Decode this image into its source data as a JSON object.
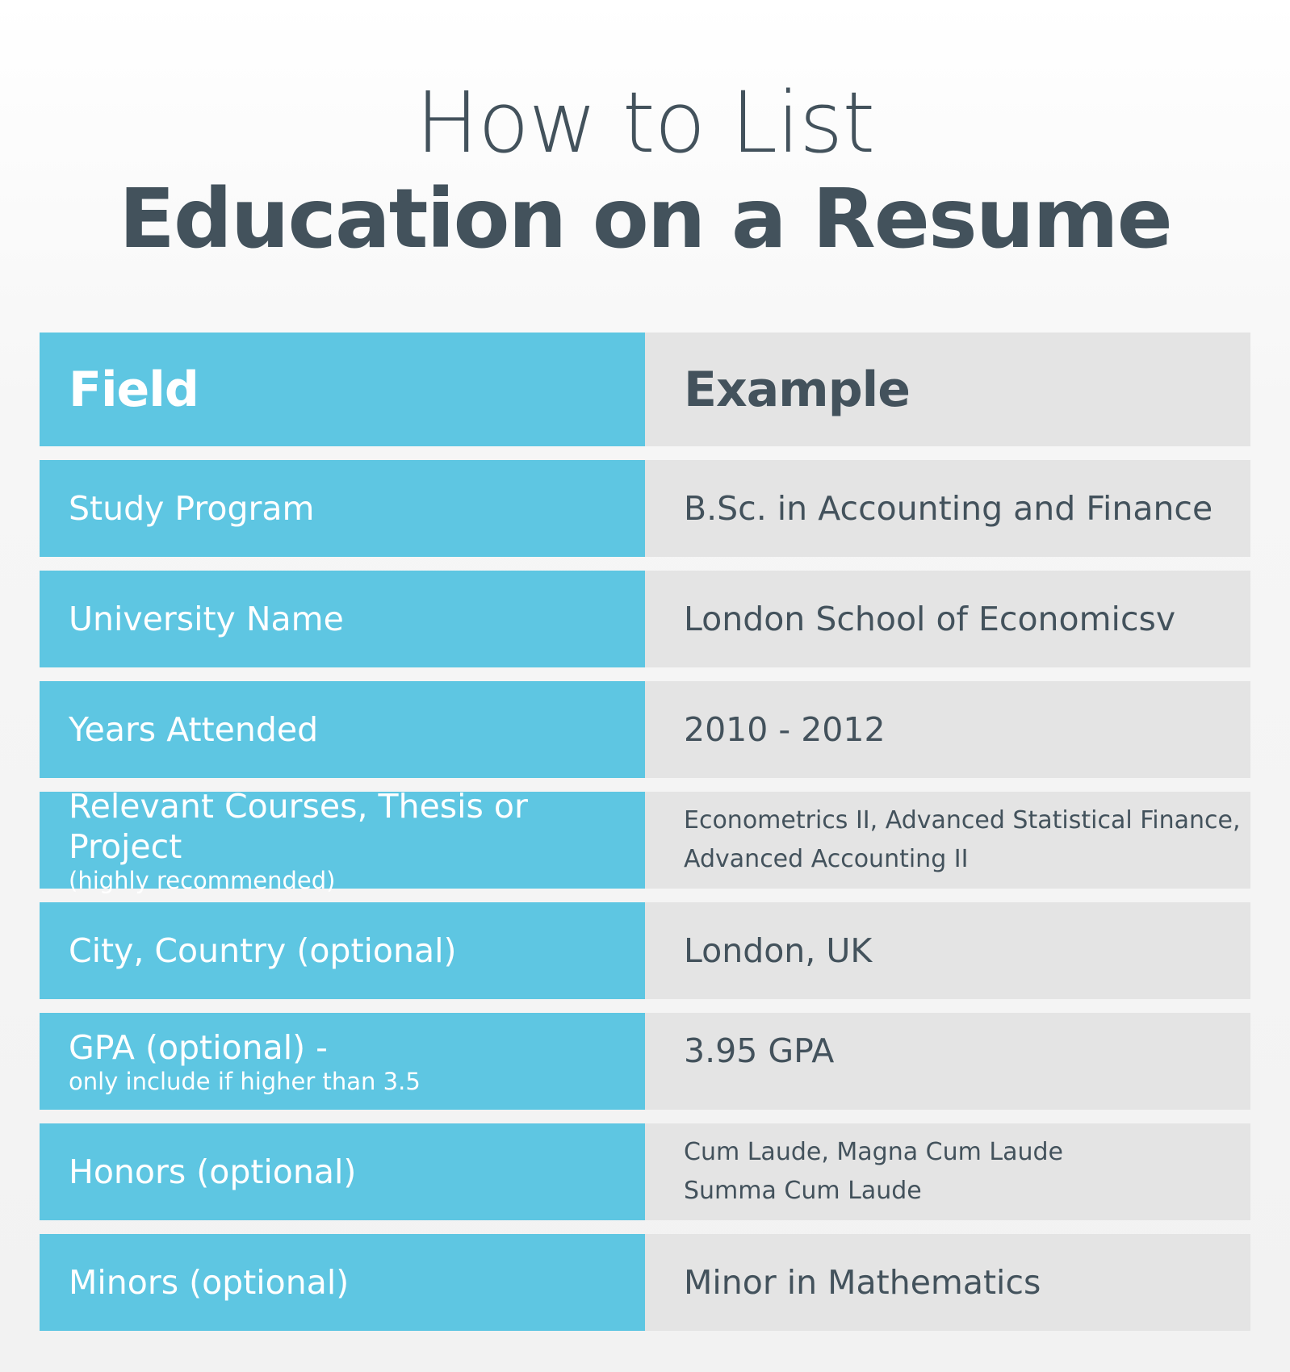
{
  "title": {
    "line1": "How to List",
    "line2": "Education on a Resume"
  },
  "table": {
    "headers": {
      "field": "Field",
      "example": "Example"
    },
    "rows": [
      {
        "field": "Study Program",
        "example": "B.Sc. in Accounting and Finance"
      },
      {
        "field": "University Name",
        "example": "London School of Economicsv"
      },
      {
        "field": "Years Attended",
        "example": "2010 - 2012"
      },
      {
        "field": "Relevant Courses, Thesis or Project",
        "field_note": "(highly recommended)",
        "example_lines": [
          "Econometrics II, Advanced Statistical Finance,",
          "Advanced Accounting II"
        ]
      },
      {
        "field": "City, Country (optional)",
        "example": "London, UK"
      },
      {
        "field": "GPA (optional) -",
        "field_note": "only include if higher than 3.5",
        "example": "3.95 GPA"
      },
      {
        "field": "Honors (optional)",
        "example_lines": [
          "Cum Laude, Magna Cum Laude",
          "Summa Cum Laude"
        ]
      },
      {
        "field": "Minors (optional)",
        "example": "Minor in Mathematics"
      }
    ]
  },
  "colors": {
    "field_column": "#5ec6e2",
    "example_column": "#e4e4e4",
    "text_dark": "#43525c",
    "text_light": "#ffffff"
  }
}
